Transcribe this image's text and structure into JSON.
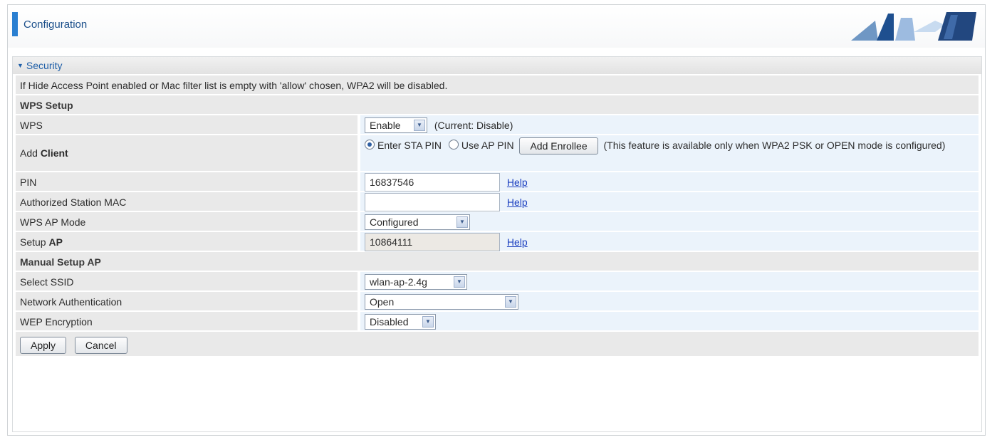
{
  "header": {
    "title": "Configuration"
  },
  "panel": {
    "title": "Security"
  },
  "notice": "If Hide Access Point enabled or Mac filter list is empty with 'allow' chosen, WPA2 will be disabled.",
  "wps_section": {
    "title": "WPS Setup",
    "wps": {
      "label": "WPS",
      "value": "Enable",
      "current": "(Current: Disable)"
    },
    "add_client": {
      "label_prefix": "Add ",
      "label_bold": "Client",
      "option_sta": "Enter STA PIN",
      "option_ap": "Use AP PIN",
      "selected": "Enter STA PIN",
      "button": "Add Enrollee",
      "note": "(This feature is available only when WPA2 PSK or OPEN mode is configured)"
    },
    "pin": {
      "label": "PIN",
      "value": "16837546",
      "help": "Help"
    },
    "authorized_mac": {
      "label": "Authorized Station MAC",
      "value": "",
      "help": "Help"
    },
    "ap_mode": {
      "label": "WPS AP Mode",
      "value": "Configured"
    },
    "setup_ap": {
      "label_prefix": "Setup ",
      "label_bold": "AP",
      "value": "10864111",
      "help": "Help"
    }
  },
  "manual_section": {
    "title": "Manual Setup AP",
    "ssid": {
      "label": "Select SSID",
      "value": "wlan-ap-2.4g"
    },
    "auth": {
      "label": "Network Authentication",
      "value": "Open"
    },
    "wep": {
      "label": "WEP Encryption",
      "value": "Disabled"
    }
  },
  "buttons": {
    "apply": "Apply",
    "cancel": "Cancel"
  },
  "colors": {
    "accent": "#2a7fd1",
    "link": "#1b3fc0",
    "value_bg": "#ebf3fb",
    "label_bg": "#e9e9e9"
  }
}
